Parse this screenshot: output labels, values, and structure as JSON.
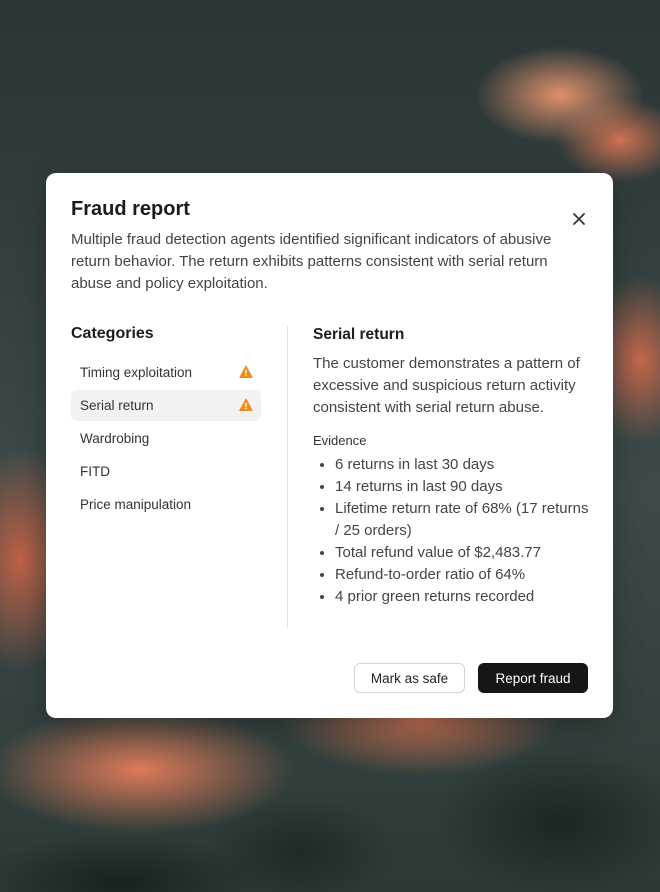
{
  "modal": {
    "title": "Fraud report",
    "description": "Multiple fraud detection agents identified significant indicators of abusive return behavior. The return exhibits patterns consistent with serial return abuse and policy exploitation.",
    "close_icon": "close-icon"
  },
  "categories": {
    "heading": "Categories",
    "items": [
      {
        "label": "Timing exploitation",
        "flagged": true,
        "active": false
      },
      {
        "label": "Serial return",
        "flagged": true,
        "active": true
      },
      {
        "label": "Wardrobing",
        "flagged": false,
        "active": false
      },
      {
        "label": "FITD",
        "flagged": false,
        "active": false
      },
      {
        "label": "Price manipulation",
        "flagged": false,
        "active": false
      }
    ],
    "warning_icon": "warning-triangle-icon",
    "warning_color": "#f08c1a"
  },
  "detail": {
    "title": "Serial return",
    "description": "The customer demonstrates a pattern of excessive and suspicious return activity consistent with serial return abuse.",
    "evidence_label": "Evidence",
    "evidence": [
      "6 returns in last 30 days",
      "14 returns in last 90 days",
      "Lifetime return rate of 68% (17 returns / 25 orders)",
      "Total refund value of $2,483.77",
      "Refund-to-order ratio of 64%",
      "4 prior green returns recorded"
    ]
  },
  "actions": {
    "mark_safe_label": "Mark as safe",
    "report_fraud_label": "Report fraud"
  }
}
